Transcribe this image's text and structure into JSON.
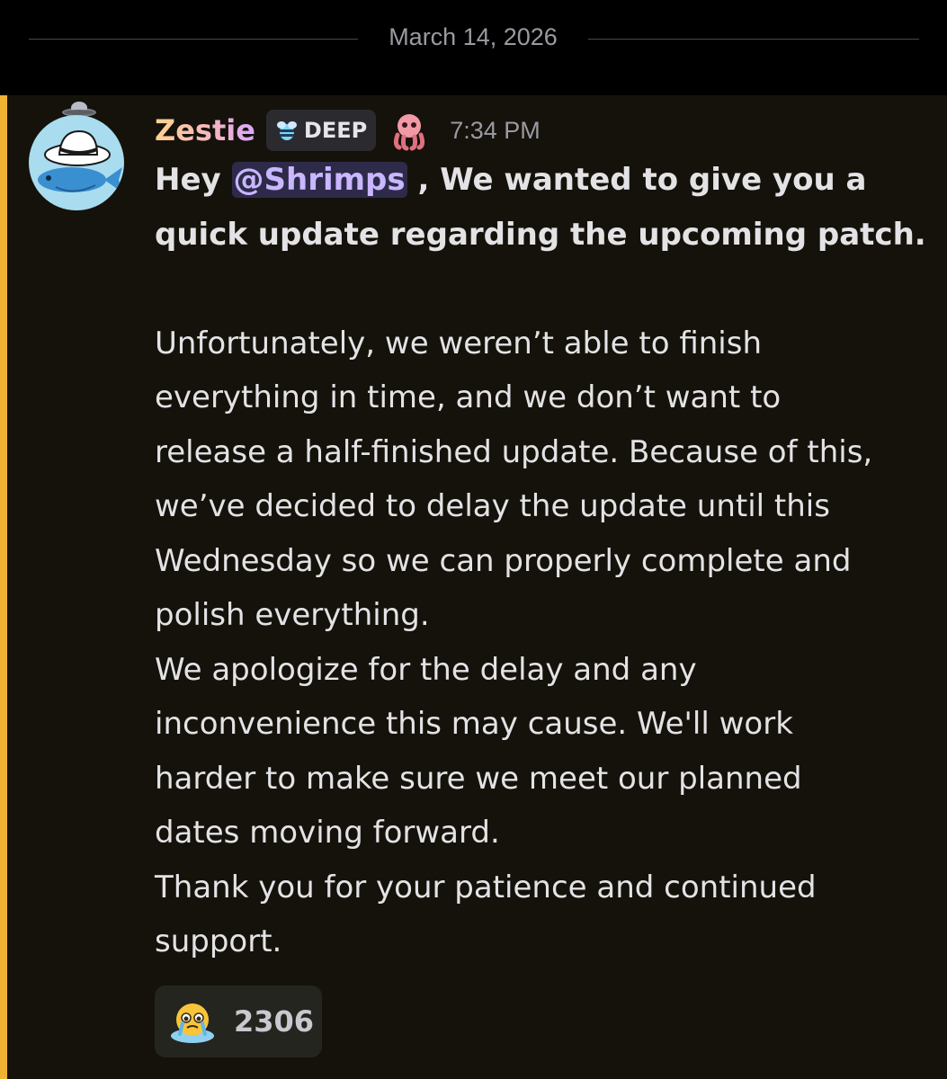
{
  "date_divider": "March 14, 2026",
  "message": {
    "author": "Zestie",
    "tag_label": "DEEP",
    "timestamp": "7:34 PM",
    "greeting_prefix": "Hey ",
    "mention": "@Shrimps",
    "greeting_suffix": " , We wanted to give you a",
    "bold_line_2": "quick update regarding the upcoming patch.",
    "lines": [
      "Unfortunately, we weren’t able to finish",
      "everything in time, and we don’t want to",
      "release a half-finished update. Because of this,",
      "we’ve decided to delay the update until this",
      "Wednesday so we can properly complete and",
      "polish everything.",
      "We apologize for the delay and any",
      "inconvenience this may cause. We'll work",
      "harder to make sure we meet our planned",
      "dates moving forward.",
      "Thank you for your patience and continued",
      "support."
    ],
    "reaction": {
      "emoji": "crying-face-emoji",
      "count": "2306"
    }
  },
  "colors": {
    "accent_bar": "#f0b232",
    "mention_bg": "#2e2a4a",
    "mention_text": "#c9b7ff",
    "message_bg": "#15120b"
  }
}
